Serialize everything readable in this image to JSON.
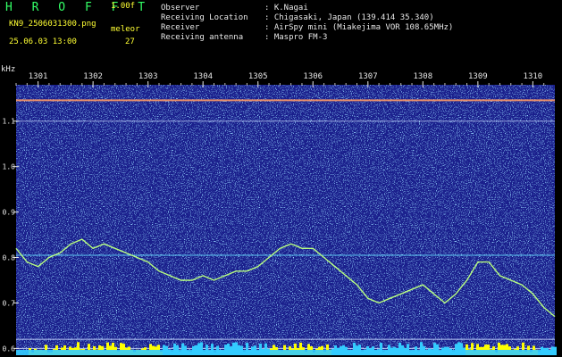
{
  "header": {
    "brand": "H R O F F T",
    "version": "1.00f",
    "filename": "KN9_2506031300.png",
    "program": "meleor",
    "datetime": "25.06.03 13:00",
    "count": "27",
    "fields": [
      {
        "label": "Observer",
        "value": ": K.Nagai"
      },
      {
        "label": "Receiving Location",
        "value": ": Chigasaki, Japan (139.414 35.340)"
      },
      {
        "label": "Receiver",
        "value": ": AirSpy mini (Miakejima VOR 108.65MHz)"
      },
      {
        "label": "Receiving antenna",
        "value": ": Maspro FM-3"
      }
    ]
  },
  "colors": {
    "background": "#000000",
    "spectrogram_bg": "#1a1f8c",
    "noise_light": "#4fb0ff",
    "trace": "#b8ff80",
    "carrier": "#ff9966",
    "yellow_bars": "#ffff00",
    "cyan_bars": "#33ccff"
  },
  "chart_data": {
    "type": "heatmap",
    "ylabel": "kHz",
    "x_ticks": [
      "1301",
      "1302",
      "1303",
      "1304",
      "1305",
      "1306",
      "1307",
      "1308",
      "1309",
      "1310"
    ],
    "y_ticks": [
      "1.1",
      "1.0",
      "0.9",
      "0.8",
      "0.7",
      "0.6"
    ],
    "y_tick_values": [
      1.1,
      1.0,
      0.9,
      0.8,
      0.7,
      0.6
    ],
    "xlim": [
      1300.6,
      1310.4
    ],
    "ylim": [
      0.585,
      1.18
    ],
    "horizontal_lines_khz": [
      1.146,
      1.1,
      0.805,
      0.62,
      0.6
    ],
    "trace": {
      "x": [
        1300.6,
        1300.8,
        1301.0,
        1301.2,
        1301.4,
        1301.6,
        1301.8,
        1302.0,
        1302.2,
        1302.4,
        1302.6,
        1302.8,
        1303.0,
        1303.2,
        1303.4,
        1303.6,
        1303.8,
        1304.0,
        1304.2,
        1304.4,
        1304.6,
        1304.8,
        1305.0,
        1305.2,
        1305.4,
        1305.6,
        1305.8,
        1306.0,
        1306.2,
        1306.4,
        1306.6,
        1306.8,
        1307.0,
        1307.2,
        1307.4,
        1307.6,
        1307.8,
        1308.0,
        1308.2,
        1308.4,
        1308.6,
        1308.8,
        1309.0,
        1309.2,
        1309.4,
        1309.6,
        1309.8,
        1310.0,
        1310.2,
        1310.4
      ],
      "y": [
        0.82,
        0.79,
        0.78,
        0.8,
        0.81,
        0.83,
        0.84,
        0.82,
        0.83,
        0.82,
        0.81,
        0.8,
        0.79,
        0.77,
        0.76,
        0.75,
        0.75,
        0.76,
        0.75,
        0.76,
        0.77,
        0.77,
        0.78,
        0.8,
        0.82,
        0.83,
        0.82,
        0.82,
        0.8,
        0.78,
        0.76,
        0.74,
        0.71,
        0.7,
        0.71,
        0.72,
        0.73,
        0.74,
        0.72,
        0.7,
        0.72,
        0.75,
        0.79,
        0.79,
        0.76,
        0.75,
        0.74,
        0.72,
        0.69,
        0.67
      ]
    }
  }
}
